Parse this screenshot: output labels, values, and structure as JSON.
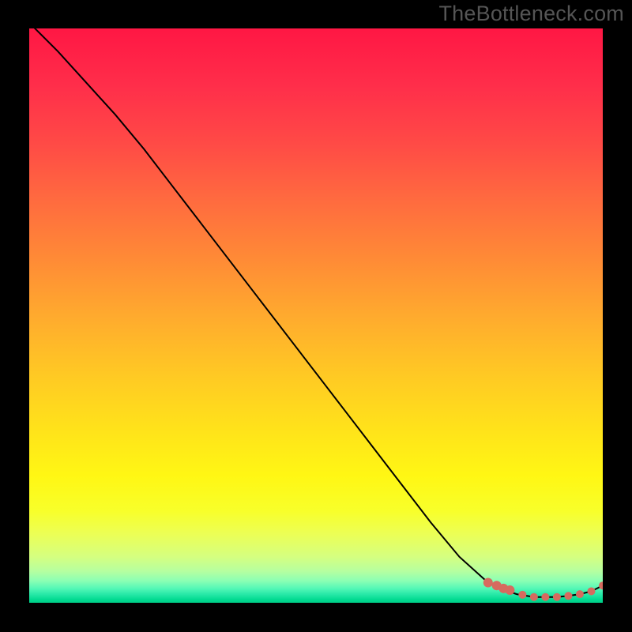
{
  "watermark": "TheBottleneck.com",
  "colors": {
    "frame": "#000000",
    "line": "#000000",
    "marker": "#d66a5f",
    "gradient_stops": [
      {
        "offset": 0.0,
        "color": "#ff1744"
      },
      {
        "offset": 0.1,
        "color": "#ff2e4a"
      },
      {
        "offset": 0.2,
        "color": "#ff4a46"
      },
      {
        "offset": 0.3,
        "color": "#ff6b3f"
      },
      {
        "offset": 0.4,
        "color": "#ff8a36"
      },
      {
        "offset": 0.5,
        "color": "#ffaa2e"
      },
      {
        "offset": 0.6,
        "color": "#ffc824"
      },
      {
        "offset": 0.7,
        "color": "#ffe31a"
      },
      {
        "offset": 0.78,
        "color": "#fff714"
      },
      {
        "offset": 0.84,
        "color": "#f8ff2a"
      },
      {
        "offset": 0.88,
        "color": "#ecff55"
      },
      {
        "offset": 0.92,
        "color": "#d5ff80"
      },
      {
        "offset": 0.945,
        "color": "#b6ffa0"
      },
      {
        "offset": 0.962,
        "color": "#8affb4"
      },
      {
        "offset": 0.975,
        "color": "#54f7b6"
      },
      {
        "offset": 0.985,
        "color": "#29e9a8"
      },
      {
        "offset": 0.995,
        "color": "#00d98f"
      },
      {
        "offset": 1.0,
        "color": "#00cf88"
      }
    ]
  },
  "chart_data": {
    "type": "line",
    "x_range": [
      0,
      100
    ],
    "y_range": [
      0,
      100
    ],
    "title": "",
    "xlabel": "",
    "ylabel": "",
    "series": [
      {
        "name": "bottleneck-curve",
        "x": [
          0,
          5,
          10,
          15,
          20,
          25,
          30,
          35,
          40,
          45,
          50,
          55,
          60,
          65,
          70,
          75,
          80,
          82,
          85,
          88,
          90,
          92,
          94,
          96,
          98,
          100
        ],
        "y": [
          101,
          96,
          90.5,
          85,
          79,
          72.5,
          66,
          59.5,
          53,
          46.5,
          40,
          33.5,
          27,
          20.5,
          14,
          8,
          3.5,
          2.5,
          1.5,
          1.0,
          1.0,
          1.0,
          1.2,
          1.5,
          2.0,
          3.0
        ]
      }
    ],
    "markers": {
      "name": "highlighted-points",
      "x": [
        80,
        81.5,
        82.7,
        83.8,
        86,
        88,
        90,
        92,
        94,
        96,
        98,
        100
      ],
      "y": [
        3.5,
        3.0,
        2.5,
        2.2,
        1.4,
        1.0,
        1.0,
        1.0,
        1.2,
        1.5,
        2.0,
        3.0
      ]
    }
  }
}
